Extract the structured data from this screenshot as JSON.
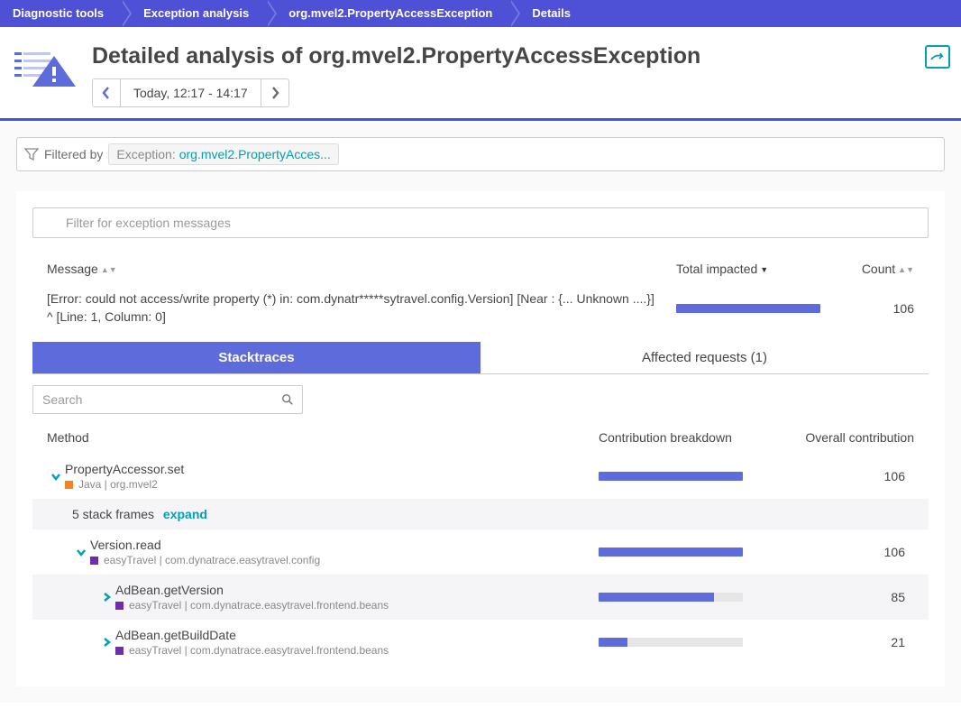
{
  "breadcrumbs": [
    "Diagnostic tools",
    "Exception analysis",
    "org.mvel2.PropertyAccessException",
    "Details"
  ],
  "page_title": "Detailed analysis of org.mvel2.PropertyAccessException",
  "time_range": "Today, 12:17 - 14:17",
  "filter_bar": {
    "label": "Filtered by",
    "pill_key": "Exception:",
    "pill_val": "org.mvel2.PropertyAcces..."
  },
  "msg_filter_placeholder": "Filter for exception messages",
  "msg_table": {
    "cols": {
      "message": "Message",
      "impacted": "Total impacted",
      "count": "Count"
    },
    "row": {
      "text": "[Error: could not access/write property (*) in: com.dynatr*****sytravel.config.Version] [Near : {... Unknown ....}] ^ [Line: 1, Column: 0]",
      "count": "106",
      "bar_pct": 100
    }
  },
  "tabs": {
    "stacktraces": "Stacktraces",
    "affected": "Affected requests (1)"
  },
  "search_placeholder": "Search",
  "trace": {
    "cols": {
      "method": "Method",
      "breakdown": "Contribution breakdown",
      "overall": "Overall contribution"
    },
    "rows": [
      {
        "type": "method",
        "indent": 0,
        "chevron": "down",
        "name": "PropertyAccessor.set",
        "tech": "Java",
        "pkg": "org.mvel2",
        "tech_color": "orange",
        "count": "106",
        "pct": 100
      },
      {
        "type": "frames",
        "indent": 0,
        "text": "5 stack frames",
        "action": "expand"
      },
      {
        "type": "method",
        "indent": 1,
        "chevron": "down",
        "name": "Version.read",
        "tech": "easyTravel",
        "pkg": "com.dynatrace.easytravel.config",
        "tech_color": "purple",
        "count": "106",
        "pct": 100
      },
      {
        "type": "method",
        "indent": 2,
        "chevron": "right",
        "name": "AdBean.getVersion",
        "tech": "easyTravel",
        "pkg": "com.dynatrace.easytravel.frontend.beans",
        "tech_color": "purple",
        "count": "85",
        "pct": 80,
        "alt": true
      },
      {
        "type": "method",
        "indent": 2,
        "chevron": "right",
        "name": "AdBean.getBuildDate",
        "tech": "easyTravel",
        "pkg": "com.dynatrace.easytravel.frontend.beans",
        "tech_color": "purple",
        "count": "21",
        "pct": 20
      }
    ]
  }
}
